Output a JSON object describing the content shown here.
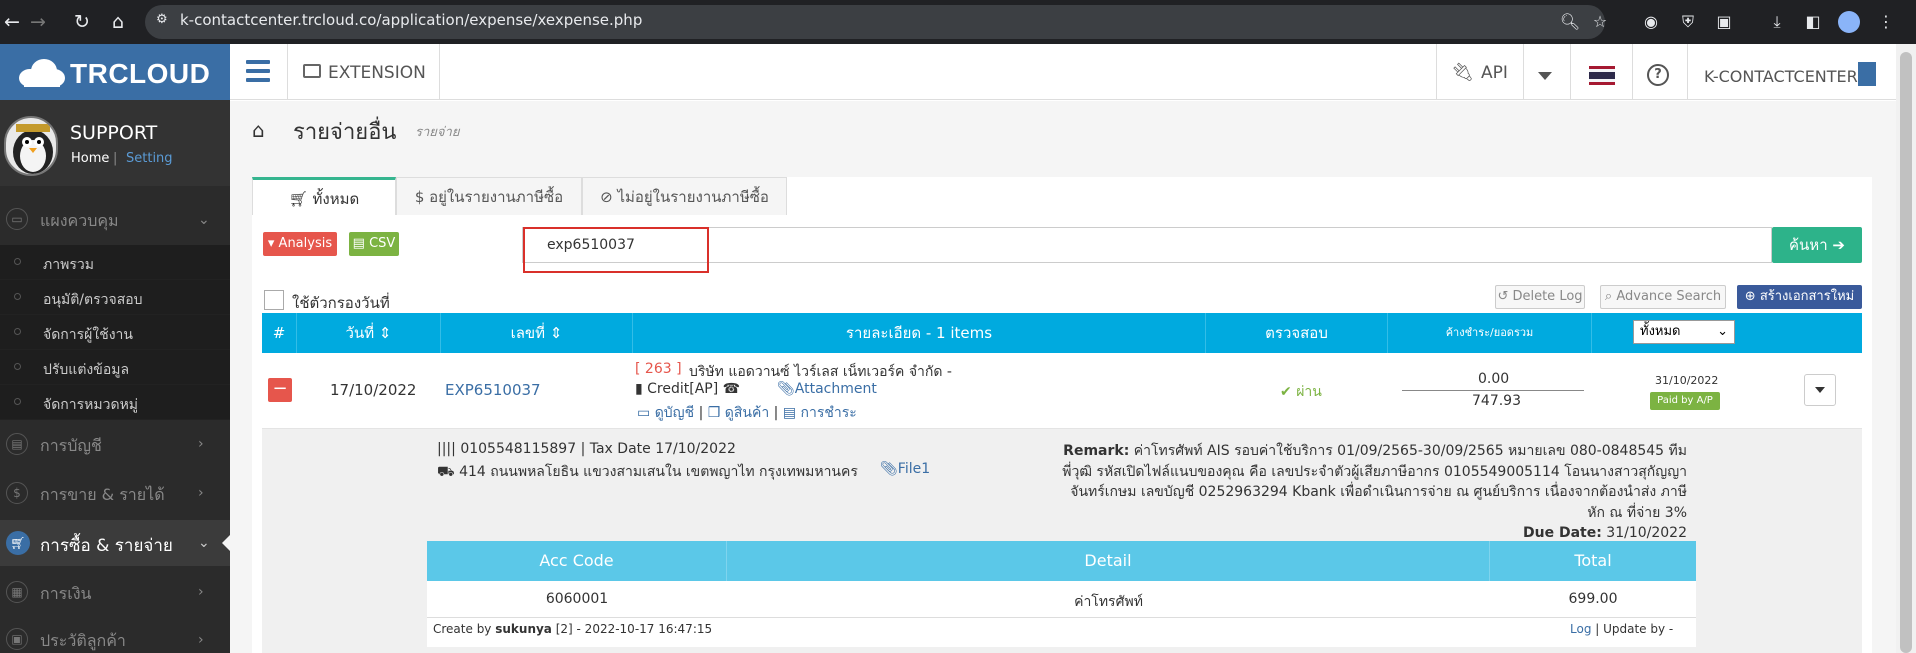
{
  "browser": {
    "url": "k-contactcenter.trcloud.co/application/expense/xexpense.php"
  },
  "sidebar": {
    "logo": "TRCLOUD",
    "profile": {
      "name": "SUPPORT",
      "home": "Home",
      "setting": "Setting"
    },
    "groups": [
      {
        "label": "แผงควบคุม"
      },
      {
        "label": "การบัญชี"
      },
      {
        "label": "การขาย & รายได้"
      },
      {
        "label": "การซื้อ & รายจ่าย"
      },
      {
        "label": "การเงิน"
      },
      {
        "label": "ประวัติลูกค้า"
      }
    ],
    "sub_items": [
      "ภาพรวม",
      "อนุมัติ/ตรวจสอบ",
      "จัดการผู้ใช้งาน",
      "ปรับแต่งข้อมูล",
      "จัดการหมวดหมู่"
    ]
  },
  "topbar": {
    "extension": "EXTENSION",
    "api": "API",
    "company": "K-CONTACTCENTER"
  },
  "page": {
    "title": "รายจ่ายอื่น",
    "subtitle": "รายจ่าย"
  },
  "tabs": [
    "ทั้งหมด",
    "อยู่ในรายงานภาษีซื้อ",
    "ไม่อยู่ในรายงานภาษีซื้อ"
  ],
  "toolbar": {
    "analysis": "Analysis",
    "csv": "CSV",
    "search_value": "exp6510037",
    "search_button": "ค้นหา",
    "date_filter": "ใช้ตัวกรองวันที่",
    "delete_log": "Delete Log",
    "advance_search": "Advance Search",
    "create_new": "สร้างเอกสารใหม่"
  },
  "table": {
    "headers": {
      "num": "#",
      "date": "วันที่",
      "docno": "เลขที่",
      "detail": "รายละเอียด - 1 items",
      "check": "ตรวจสอบ",
      "balance": "ค้างชำระ/ยอดรวม",
      "filter": "ทั้งหมด"
    },
    "row": {
      "date": "17/10/2022",
      "docno": "EXP6510037",
      "vendor_code": "[ 263 ]",
      "vendor": "บริษัท แอดวานซ์ ไวร์เลส เน็ทเวอร์ค จำกัด -",
      "credit": "Credit[AP]",
      "attachment": "Attachment",
      "view_account": "ดูบัญชี",
      "view_product": "ดูสินค้า",
      "payment": "การชำระ",
      "status": "ผ่าน",
      "balance": "0.00",
      "total": "747.93",
      "due_date": "31/10/2022",
      "paid_badge": "Paid by A/P"
    },
    "detail": {
      "taxid_line": "0105548115897 | Tax Date 17/10/2022",
      "address": "414 ถนนพหลโยธิน แขวงสามเสนใน เขตพญาไท กรุงเทพมหานคร",
      "file": "File1",
      "remark_label": "Remark:",
      "remark": "ค่าโทรศัพท์ AIS รอบค่าใช้บริการ 01/09/2565-30/09/2565 หมายเลข 080-0848545 ทีมพี่วุฒิ รหัสเปิดไฟล์แนบของคุณ คือ เลขประจำตัวผู้เสียภาษีอากร 0105549005114 โอนนางสาวสุกัญญา จันทร์เกษม เลขบัญชี 0252963294 Kbank เพื่อดำเนินการจ่าย ณ ศูนย์บริการ เนื่องจากต้องนำส่ง ภาษีหัก ณ ที่จ่าย 3%",
      "due_label": "Due Date:",
      "due_value": "31/10/2022",
      "sub_headers": [
        "Acc Code",
        "Detail",
        "Total"
      ],
      "sub_row": [
        "6060001",
        "ค่าโทรศัพท์",
        "699.00"
      ],
      "create_prefix": "Create by ",
      "create_user": "sukunya",
      "create_suffix": " [2] - 2022-10-17 16:47:15",
      "log": "Log",
      "update": " | Update by -"
    }
  },
  "colors": {
    "brand": "#3a6ea5",
    "table_header": "#00aadf",
    "success": "#2db38a",
    "danger": "#e6564c"
  }
}
